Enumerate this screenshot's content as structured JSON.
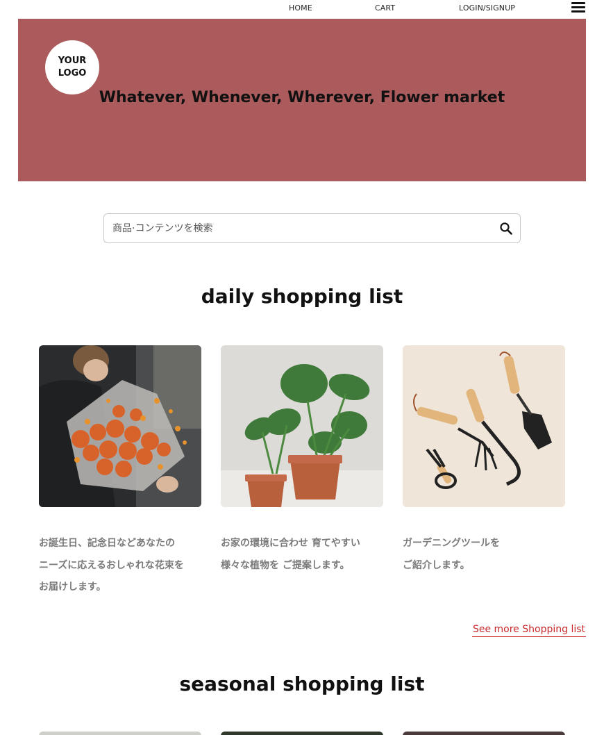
{
  "nav": {
    "home": "HOME",
    "cart": "CART",
    "login": "LOGIN/SIGNUP"
  },
  "banner": {
    "logo_text": "YOUR\nLOGO",
    "tagline": "Whatever, Whenever, Wherever, Flower market",
    "background_color": "#ac5b5d"
  },
  "search": {
    "placeholder": "商品·コンテンツを検索",
    "value": ""
  },
  "daily": {
    "title": "daily shopping list",
    "cards": [
      {
        "desc": "お誕生日、記念日などあなたの\nニーズに応えるおしゃれな花束を\nお届けします。",
        "icon": "orange-flower-bouquet-photo"
      },
      {
        "desc": "お家の環境に合わせ 育てやすい\n様々な植物を ご提案します。",
        "icon": "potted-monstera-plants-photo"
      },
      {
        "desc": "ガーデニングツールを\nご紹介します。",
        "icon": "garden-tools-photo"
      }
    ],
    "see_more": "See more Shopping list"
  },
  "seasonal": {
    "title": "seasonal shopping list"
  },
  "colors": {
    "accent_red": "#c8282b",
    "desc_gray": "#7a7a7a"
  }
}
